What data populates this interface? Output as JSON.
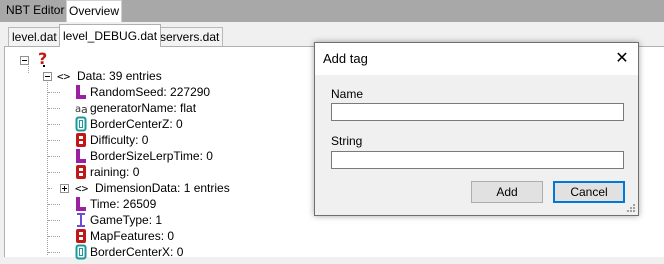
{
  "main_tabs": [
    "NBT Editor",
    "Overview"
  ],
  "file_tabs": [
    "level.dat",
    "level_DEBUG.dat",
    "servers.dat"
  ],
  "tree": {
    "root_icon": "question-mark-icon",
    "data_label": "Data: 39 entries",
    "items": [
      {
        "text": "RandomSeed: 227290",
        "icon": "long-tag-icon"
      },
      {
        "text": "generatorName: flat",
        "icon": "string-tag-icon"
      },
      {
        "text": "BorderCenterZ: 0",
        "icon": "double-tag-icon"
      },
      {
        "text": "Difficulty: 0",
        "icon": "byte-tag-icon"
      },
      {
        "text": "BorderSizeLerpTime: 0",
        "icon": "long-tag-icon"
      },
      {
        "text": "raining: 0",
        "icon": "byte-tag-icon"
      },
      {
        "text": "DimensionData: 1 entries",
        "icon": "compound-tag-icon"
      },
      {
        "text": "Time: 26509",
        "icon": "long-tag-icon"
      },
      {
        "text": "GameType: 1",
        "icon": "int-tag-icon"
      },
      {
        "text": "MapFeatures: 0",
        "icon": "byte-tag-icon"
      },
      {
        "text": "BorderCenterX: 0",
        "icon": "double-tag-icon"
      }
    ]
  },
  "dialog": {
    "title": "Add tag",
    "name_label": "Name",
    "name_value": "",
    "string_label": "String",
    "string_value": "",
    "add_label": "Add",
    "cancel_label": "Cancel"
  },
  "colors": {
    "long": "#9b1fa3",
    "byte": "#c01818",
    "double": "#1a9a9a",
    "int": "#6a4fd6",
    "root": "#c01818",
    "accent": "#0078d7"
  }
}
